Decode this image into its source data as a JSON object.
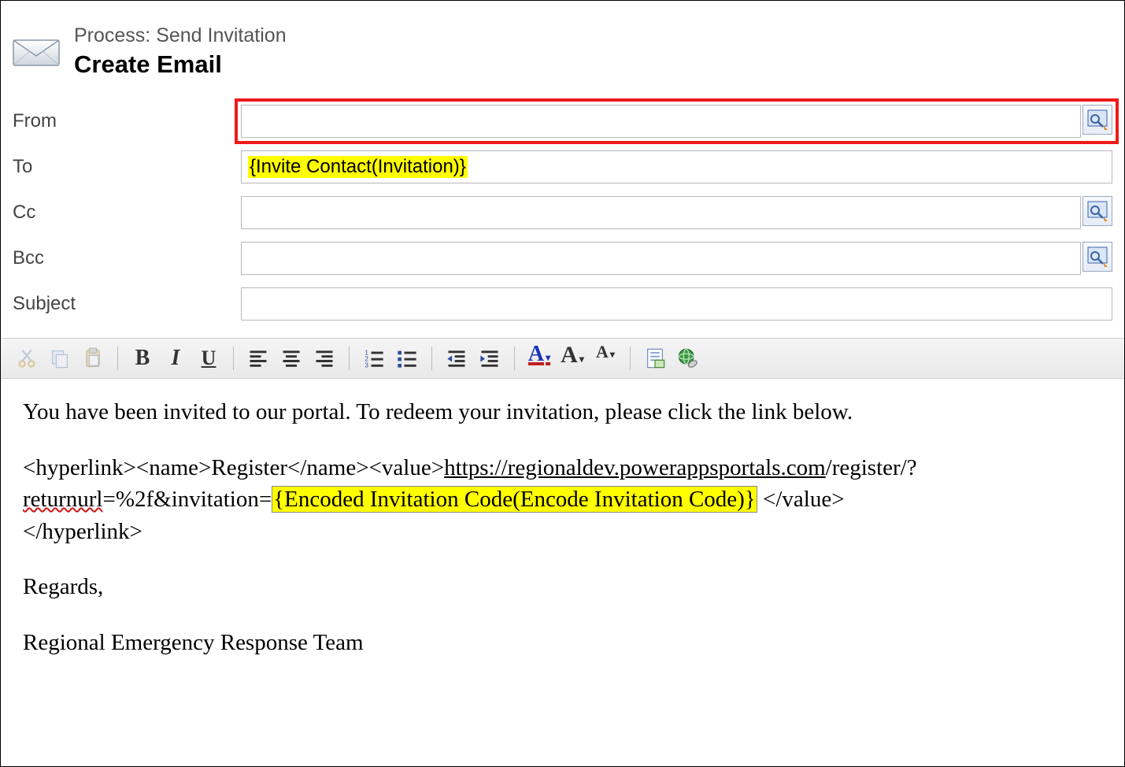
{
  "header": {
    "process_label": "Process: Send Invitation",
    "title": "Create Email"
  },
  "fields": {
    "from": {
      "label": "From",
      "value": ""
    },
    "to": {
      "label": "To",
      "value": "{Invite Contact(Invitation)}"
    },
    "cc": {
      "label": "Cc",
      "value": ""
    },
    "bcc": {
      "label": "Bcc",
      "value": ""
    },
    "subject": {
      "label": "Subject",
      "value": ""
    }
  },
  "toolbar": {
    "bold": "B",
    "italic": "I",
    "underline": "U",
    "fontA1": "A",
    "fontA2": "A",
    "fontA3": "A"
  },
  "body": {
    "line1": "You have been invited to our portal. To redeem your invitation, please click the link below.",
    "hl_open": "<hyperlink><name>Register</name><value>",
    "url_text": "https://regionaldev.powerappsportals.com",
    "url_rest1": "/register/?",
    "returnurl_word": "returnurl",
    "url_rest2": "=%2f&invitation=",
    "token": "{Encoded Invitation Code(Encode Invitation Code)}",
    "hl_close1": "  </value>",
    "hl_close2": "</hyperlink>",
    "regards": "Regards,",
    "signature": "Regional Emergency Response Team"
  }
}
